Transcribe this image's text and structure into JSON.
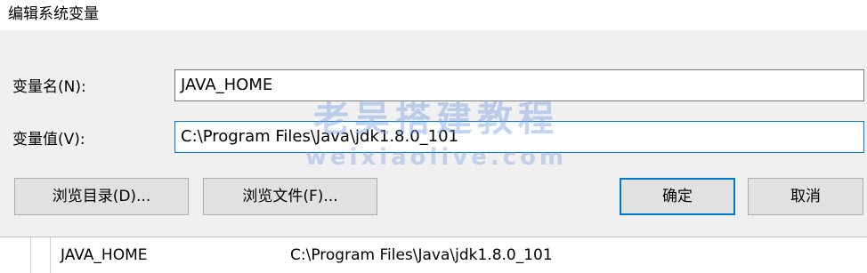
{
  "window": {
    "title": "编辑系统变量"
  },
  "form": {
    "name_label": "变量名(N):",
    "name_value": "JAVA_HOME",
    "value_label": "变量值(V):",
    "value_value": "C:\\Program Files\\Java\\jdk1.8.0_101"
  },
  "buttons": {
    "browse_dir": "浏览目录(D)...",
    "browse_file": "浏览文件(F)...",
    "ok": "确定",
    "cancel": "取消"
  },
  "list_row": {
    "name": "JAVA_HOME",
    "value": "C:\\Program Files\\Java\\jdk1.8.0_101"
  },
  "watermark": {
    "cn": "老吴搭建教程",
    "en": "weixiaolive.com"
  },
  "colors": {
    "focus_border": "#0078d7",
    "window_bg": "#f0f0f0",
    "watermark": "#78a0e1"
  }
}
